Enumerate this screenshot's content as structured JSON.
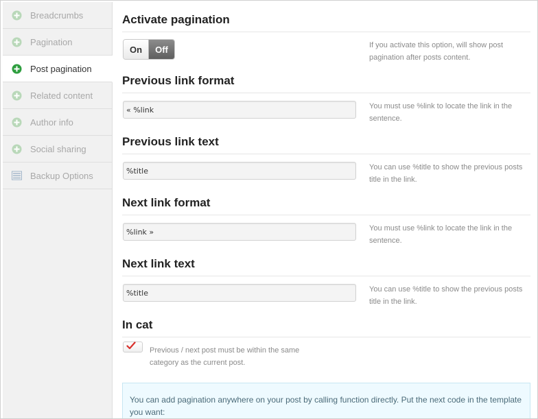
{
  "sidebar": {
    "items": [
      {
        "label": "Breadcrumbs",
        "icon": "plus-circle-icon",
        "active": false
      },
      {
        "label": "Pagination",
        "icon": "plus-circle-icon",
        "active": false
      },
      {
        "label": "Post pagination",
        "icon": "plus-circle-icon",
        "active": true
      },
      {
        "label": "Related content",
        "icon": "plus-circle-icon",
        "active": false
      },
      {
        "label": "Author info",
        "icon": "plus-circle-icon",
        "active": false
      },
      {
        "label": "Social sharing",
        "icon": "plus-circle-icon",
        "active": false
      },
      {
        "label": "Backup Options",
        "icon": "backup-icon",
        "active": false
      }
    ]
  },
  "colors": {
    "active_icon": "#2e9e3f",
    "inactive_icon": "#b9d8b9",
    "info_bg": "#eefaff",
    "check": "#d9302b"
  },
  "activate": {
    "title": "Activate pagination",
    "on_label": "On",
    "off_label": "Off",
    "selected": "Off",
    "desc": "If you activate this option, will show post pagination after posts content."
  },
  "prev_format": {
    "title": "Previous link format",
    "value": "« %link",
    "desc": "You must use %link to locate the link in the sentence."
  },
  "prev_text": {
    "title": "Previous link text",
    "value": "%title",
    "desc": "You can use %title to show the previous posts title in the link."
  },
  "next_format": {
    "title": "Next link format",
    "value": "%link »",
    "desc": "You must use %link to locate the link in the sentence."
  },
  "next_text": {
    "title": "Next link text",
    "value": "%title",
    "desc": "You can use %title to show the previous posts title in the link."
  },
  "in_cat": {
    "title": "In cat",
    "checked": true,
    "desc": "Previous / next post must be within the same category as the current post."
  },
  "info": {
    "text": "You can add pagination anywhere on your post by calling function directly. Put the next code in the template you want:"
  }
}
